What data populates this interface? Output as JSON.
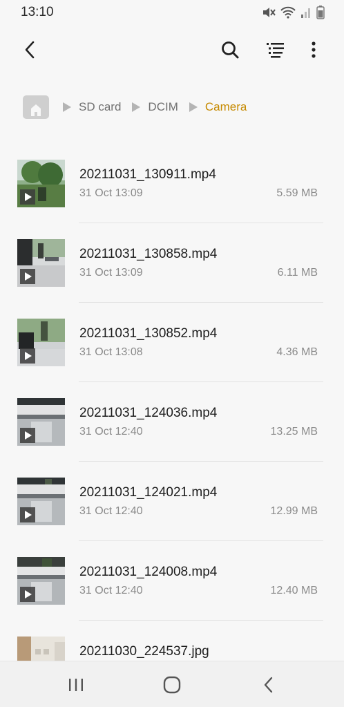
{
  "status_bar": {
    "time": "13:10",
    "icons": [
      "mute-icon",
      "wifi-icon",
      "signal-icon",
      "battery-icon"
    ]
  },
  "toolbar": {
    "back_icon": "back-arrow-icon",
    "search_icon": "search-icon",
    "sort_icon": "list-view-icon",
    "more_icon": "more-options-icon"
  },
  "breadcrumb": {
    "home_icon": "home-icon",
    "items": [
      "SD card",
      "DCIM",
      "Camera"
    ]
  },
  "files": [
    {
      "name": "20211031_130911.mp4",
      "date": "31 Oct 13:09",
      "size": "5.59 MB",
      "type": "video",
      "thumb": "garden"
    },
    {
      "name": "20211031_130858.mp4",
      "date": "31 Oct 13:09",
      "size": "6.11 MB",
      "type": "video",
      "thumb": "desk"
    },
    {
      "name": "20211031_130852.mp4",
      "date": "31 Oct 13:08",
      "size": "4.36 MB",
      "type": "video",
      "thumb": "window"
    },
    {
      "name": "20211031_124036.mp4",
      "date": "31 Oct 12:40",
      "size": "13.25 MB",
      "type": "video",
      "thumb": "table"
    },
    {
      "name": "20211031_124021.mp4",
      "date": "31 Oct 12:40",
      "size": "12.99 MB",
      "type": "video",
      "thumb": "table"
    },
    {
      "name": "20211031_124008.mp4",
      "date": "31 Oct 12:40",
      "size": "12.40 MB",
      "type": "video",
      "thumb": "table2"
    },
    {
      "name": "20211030_224537.jpg",
      "date": "",
      "size": "",
      "type": "image",
      "thumb": "room"
    }
  ],
  "nav_bar": {
    "recents_icon": "recent-apps-icon",
    "home_icon": "home-button-icon",
    "back_icon": "nav-back-icon"
  },
  "colors": {
    "accent": "#c68a00",
    "background": "#f7f7f7",
    "secondary_text": "#8a8a8a"
  }
}
